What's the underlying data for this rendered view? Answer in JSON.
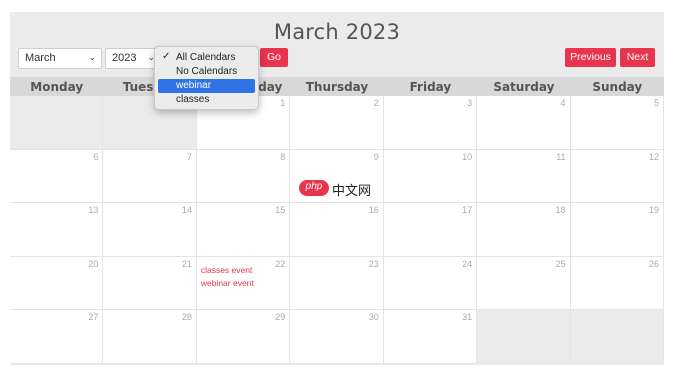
{
  "title": "March 2023",
  "controls": {
    "month": "March",
    "year": "2023",
    "go_label": "Go",
    "previous_label": "Previous",
    "next_label": "Next"
  },
  "calendar_filter": {
    "checked": "All Calendars",
    "highlighted": "webinar",
    "options": [
      "All Calendars",
      "No Calendars",
      "webinar",
      "classes"
    ]
  },
  "weekdays": [
    "Monday",
    "Tuesday",
    "Wednesday",
    "Thursday",
    "Friday",
    "Saturday",
    "Sunday"
  ],
  "cells": [
    {
      "day": ""
    },
    {
      "day": ""
    },
    {
      "day": "1"
    },
    {
      "day": "2"
    },
    {
      "day": "3"
    },
    {
      "day": "4"
    },
    {
      "day": "5"
    },
    {
      "day": "6"
    },
    {
      "day": "7"
    },
    {
      "day": "8"
    },
    {
      "day": "9"
    },
    {
      "day": "10"
    },
    {
      "day": "11"
    },
    {
      "day": "12"
    },
    {
      "day": "13"
    },
    {
      "day": "14"
    },
    {
      "day": "15"
    },
    {
      "day": "16"
    },
    {
      "day": "17"
    },
    {
      "day": "18"
    },
    {
      "day": "19"
    },
    {
      "day": "20"
    },
    {
      "day": "21"
    },
    {
      "day": "22",
      "events": [
        "classes event",
        "webinar event"
      ]
    },
    {
      "day": "23"
    },
    {
      "day": "24"
    },
    {
      "day": "25"
    },
    {
      "day": "26"
    },
    {
      "day": "27"
    },
    {
      "day": "28"
    },
    {
      "day": "29"
    },
    {
      "day": "30"
    },
    {
      "day": "31"
    },
    {
      "day": ""
    },
    {
      "day": ""
    }
  ],
  "watermark": {
    "logo": "php",
    "text": "中文网"
  },
  "colors": {
    "accent": "#e8344d",
    "highlight": "#2f73e5",
    "header_bg": "#d8d8d8"
  }
}
